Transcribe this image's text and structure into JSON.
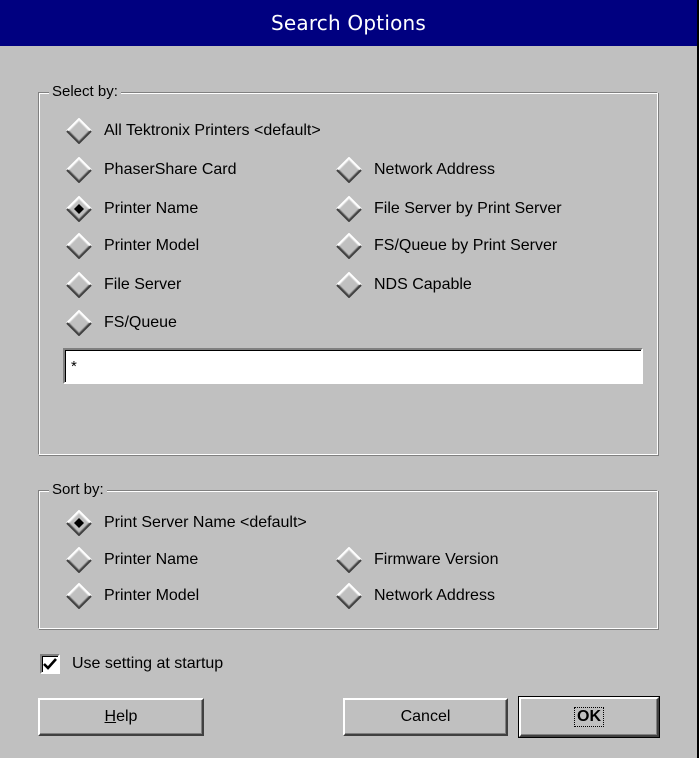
{
  "window": {
    "title": "Search Options"
  },
  "select_by": {
    "label": "Select by:",
    "options": [
      {
        "label": "All Tektronix Printers <default>",
        "checked": false
      },
      {
        "label": "PhaserShare Card",
        "checked": false
      },
      {
        "label": "Network Address",
        "checked": false
      },
      {
        "label": "Printer Name",
        "checked": true
      },
      {
        "label": "File Server by Print Server",
        "checked": false
      },
      {
        "label": "Printer Model",
        "checked": false
      },
      {
        "label": "FS/Queue by Print Server",
        "checked": false
      },
      {
        "label": "File Server",
        "checked": false
      },
      {
        "label": "NDS Capable",
        "checked": false
      },
      {
        "label": "FS/Queue",
        "checked": false
      }
    ],
    "search_value": "*"
  },
  "sort_by": {
    "label": "Sort by:",
    "options": [
      {
        "label": "Print Server Name <default>",
        "checked": true
      },
      {
        "label": "Printer Name",
        "checked": false
      },
      {
        "label": "Firmware Version",
        "checked": false
      },
      {
        "label": "Printer Model",
        "checked": false
      },
      {
        "label": "Network Address",
        "checked": false
      }
    ]
  },
  "startup": {
    "label": "Use setting at startup",
    "checked": true
  },
  "buttons": {
    "help": "Help",
    "cancel": "Cancel",
    "ok": "OK"
  },
  "colors": {
    "titlebar": "#000080",
    "face": "#c0c0c0",
    "highlight": "#ffffff",
    "shadow": "#808080"
  }
}
